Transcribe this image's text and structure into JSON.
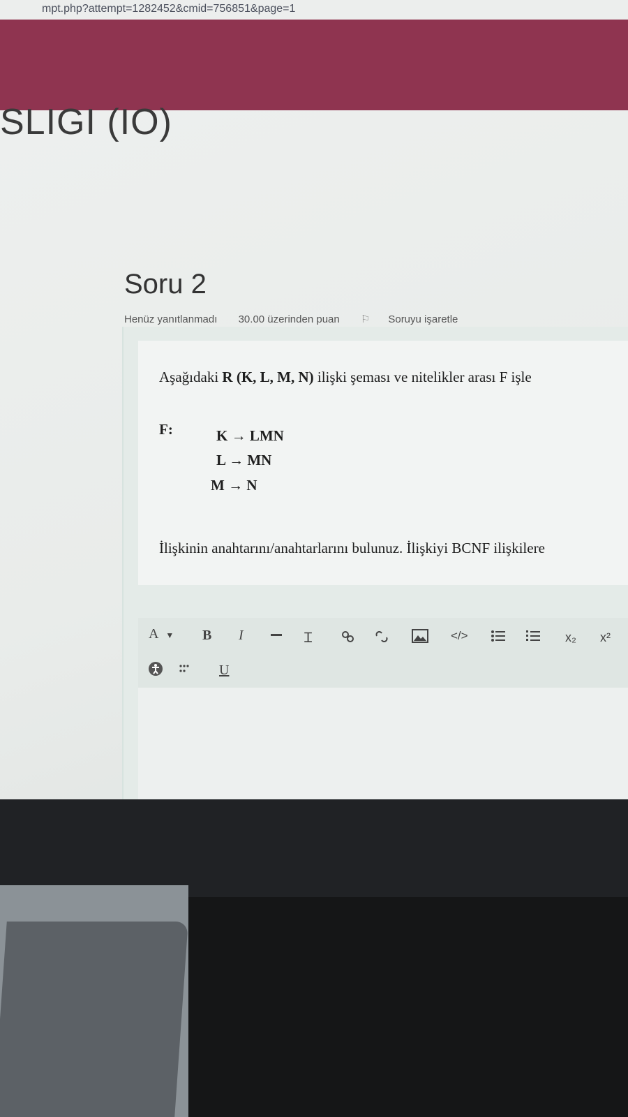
{
  "browser": {
    "url_text": "mpt.php?attempt=1282452&cmid=756851&page=1"
  },
  "page": {
    "heading": "SLIGI (IO)"
  },
  "question": {
    "title": "Soru 2",
    "status": "Henüz yanıtlanmadı",
    "points": "30.00 üzerinden puan",
    "flag_label": "Soruyu işaretle",
    "intro_prefix": "Aşağıdaki ",
    "intro_bold": "R (K, L, M, N)",
    "intro_suffix": " ilişki şeması ve nitelikler arası F işle",
    "f_label": "F:",
    "dependencies": [
      "K → LMN",
      "L → MN",
      "M → N"
    ],
    "task": "İlişkinin anahtarını/anahtarlarını bulunuz. İlişkiyi BCNF ilişkilere"
  },
  "editor": {
    "font_menu": "A",
    "bold": "B",
    "italic": "I",
    "underline": "U",
    "subscript": "x₂",
    "superscript": "x²",
    "code": "</>"
  },
  "colors": {
    "brand_band": "#8f3450",
    "screen_bg": "#eef0ef"
  },
  "icons": [
    "flag-icon",
    "chevron-down-icon",
    "strikethrough-icon",
    "text-cursor-icon",
    "link-icon",
    "unlink-icon",
    "image-icon",
    "code-icon",
    "bullet-list-icon",
    "numbered-list-icon",
    "accessibility-icon",
    "table-icon"
  ]
}
